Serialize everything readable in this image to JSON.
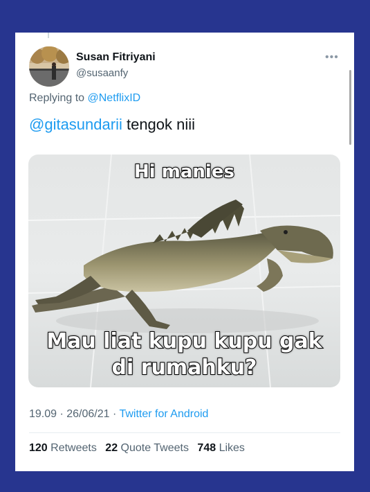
{
  "tweet": {
    "author_name": "Susan Fitriyani",
    "author_handle": "@susaanfy",
    "more_icon": "more-options-icon",
    "replying_prefix": "Replying to",
    "replying_to": "@NetflixID",
    "text_mention": "@gitasundarii",
    "text_body": " tengok niii",
    "media": {
      "caption_top": "Hi manies",
      "caption_bottom_line1": "Mau liat kupu kupu gak",
      "caption_bottom_line2": "di rumahku?"
    },
    "timestamp": "19.09 · 26/06/21 · ",
    "source": "Twitter for Android",
    "stats": {
      "retweets_count": "120",
      "retweets_label": " Retweets",
      "quotes_count": "22",
      "quotes_label": " Quote Tweets",
      "likes_count": "748",
      "likes_label": " Likes"
    }
  },
  "colors": {
    "frame": "#27358f",
    "link": "#1d9bf0",
    "secondary_text": "#536471"
  }
}
